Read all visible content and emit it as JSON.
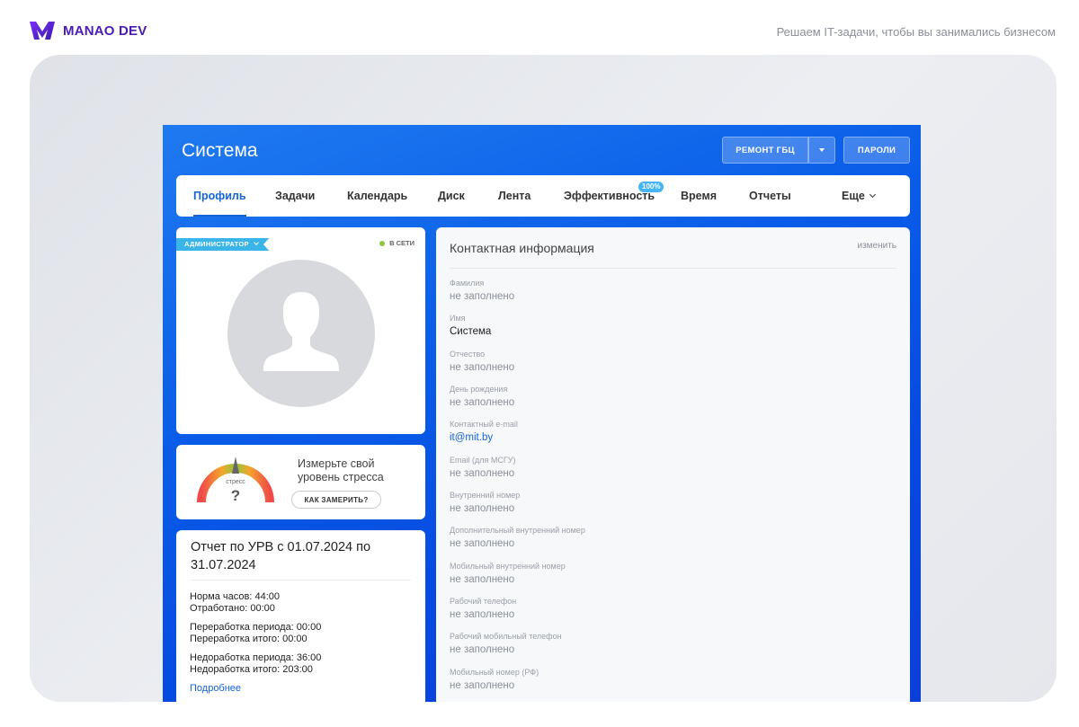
{
  "brand": {
    "name": "MANAO DEV",
    "slogan": "Решаем IT-задачи, чтобы вы занимались бизнесом",
    "color": "#4a1bb5"
  },
  "app": {
    "title": "Система",
    "buttons": {
      "repair": "РЕМОНТ ГБЦ",
      "passwords": "ПАРОЛИ"
    },
    "tabs": [
      {
        "label": "Профиль"
      },
      {
        "label": "Задачи"
      },
      {
        "label": "Календарь"
      },
      {
        "label": "Диск"
      },
      {
        "label": "Лента"
      },
      {
        "label": "Эффективность",
        "badge": "100%"
      },
      {
        "label": "Время"
      },
      {
        "label": "Отчеты"
      },
      {
        "label": "Еще"
      }
    ]
  },
  "profile": {
    "role": "АДМИНИСТРАТОР",
    "status": "В СЕТИ"
  },
  "stress": {
    "gauge_label": "стресс",
    "gauge_value": "?",
    "text": "Измерьте свой уровень стресса",
    "button": "КАК ЗАМЕРИТЬ?"
  },
  "report": {
    "title": "Отчет по УРВ с 01.07.2024 по 31.07.2024",
    "lines": [
      "Норма часов: 44:00",
      "Отработано: 00:00",
      "Переработка периода: 00:00",
      "Переработка итого: 00:00",
      "Недоработка периода: 36:00",
      "Недоработка итого: 203:00"
    ],
    "more": "Подробнее"
  },
  "contact": {
    "title": "Контактная информация",
    "edit": "изменить",
    "fields": [
      {
        "label": "Фамилия",
        "value": "не заполнено"
      },
      {
        "label": "Имя",
        "value": "Система"
      },
      {
        "label": "Отчество",
        "value": "не заполнено"
      },
      {
        "label": "День рождения",
        "value": "не заполнено"
      },
      {
        "label": "Контактный e-mail",
        "value": "it@mit.by"
      },
      {
        "label": "Email (для МСГУ)",
        "value": "не заполнено"
      },
      {
        "label": "Внутренний номер",
        "value": "не заполнено"
      },
      {
        "label": "Дополнительный внутренний номер",
        "value": "не заполнено"
      },
      {
        "label": "Мобильный внутренний номер",
        "value": "не заполнено"
      },
      {
        "label": "Рабочий телефон",
        "value": "не заполнено"
      },
      {
        "label": "Рабочий мобильный телефон",
        "value": "не заполнено"
      },
      {
        "label": "Мобильный номер (РФ)",
        "value": "не заполнено"
      }
    ]
  }
}
